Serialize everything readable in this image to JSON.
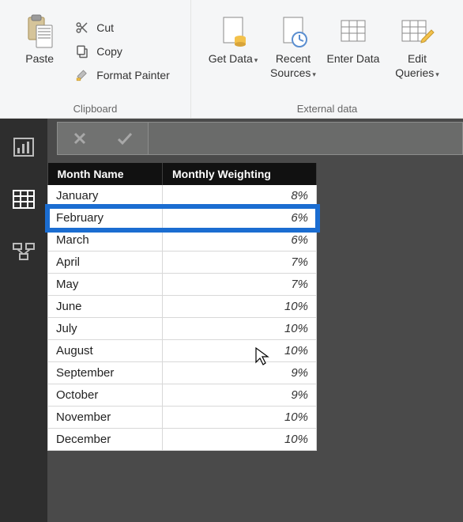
{
  "ribbon": {
    "clipboard": {
      "label": "Clipboard",
      "paste": "Paste",
      "cut": "Cut",
      "copy": "Copy",
      "format_painter": "Format Painter"
    },
    "external": {
      "label": "External data",
      "get_data": "Get Data",
      "recent_sources": "Recent Sources",
      "enter_data": "Enter Data",
      "edit_queries": "Edit Queries"
    }
  },
  "table": {
    "headers": {
      "month": "Month Name",
      "weight": "Monthly Weighting"
    },
    "rows": [
      {
        "month": "January",
        "weight": "8%"
      },
      {
        "month": "February",
        "weight": "6%"
      },
      {
        "month": "March",
        "weight": "6%"
      },
      {
        "month": "April",
        "weight": "7%"
      },
      {
        "month": "May",
        "weight": "7%"
      },
      {
        "month": "June",
        "weight": "10%"
      },
      {
        "month": "July",
        "weight": "10%"
      },
      {
        "month": "August",
        "weight": "10%"
      },
      {
        "month": "September",
        "weight": "9%"
      },
      {
        "month": "October",
        "weight": "9%"
      },
      {
        "month": "November",
        "weight": "10%"
      },
      {
        "month": "December",
        "weight": "10%"
      }
    ],
    "highlight_index": 1
  }
}
